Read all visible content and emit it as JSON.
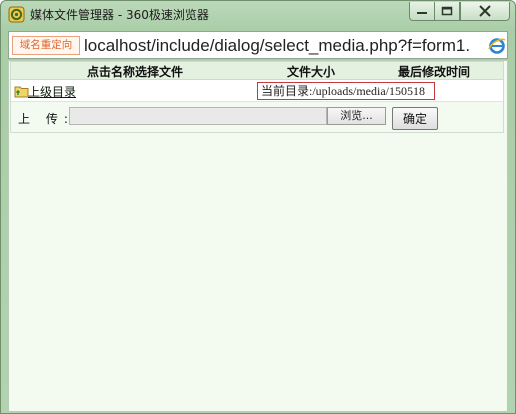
{
  "window": {
    "title": "媒体文件管理器 - 360极速浏览器",
    "controls": {
      "minimize_icon": "minimize-icon",
      "maximize_icon": "maximize-icon",
      "close_icon": "close-icon"
    }
  },
  "addressbar": {
    "redirect_tag": "域名重定向",
    "url": "localhost/include/dialog/select_media.php?f=form1.",
    "ie_icon": "ie-icon"
  },
  "table": {
    "headers": [
      "点击名称选择文件",
      "文件大小",
      "最后修改时间"
    ],
    "parent_link": "上级目录",
    "current_dir": "当前目录:/uploads/media/150518"
  },
  "upload": {
    "label": "上 传:",
    "browse_label": "浏览...",
    "confirm_label": "确定"
  },
  "colors": {
    "accent_redirect": "#e0662b",
    "frame_green": "#a9cda7",
    "current_dir_border": "#c53b3b"
  }
}
